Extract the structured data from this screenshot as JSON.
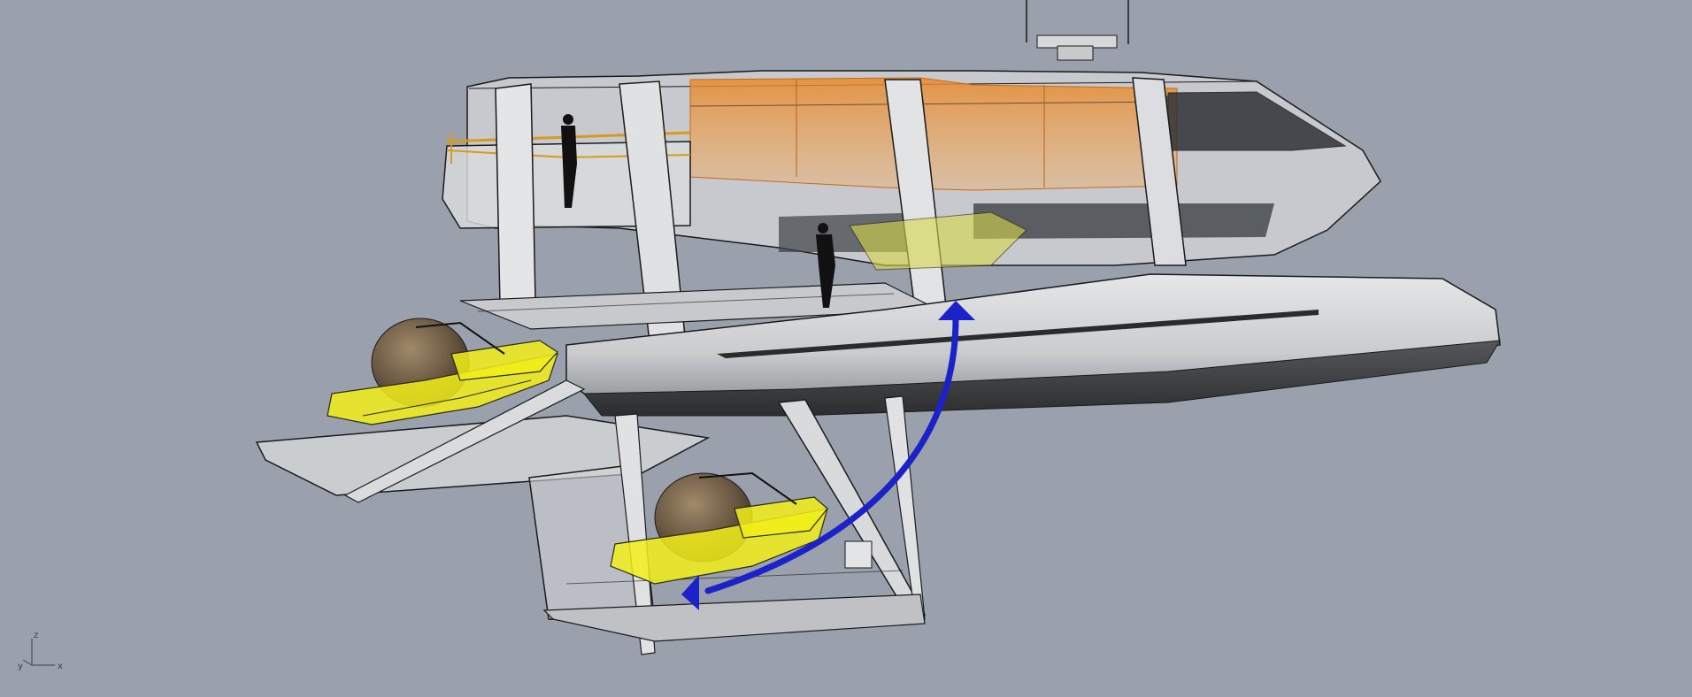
{
  "viewport": {
    "background_color": "#9aa1ac",
    "axis": {
      "z_label": "z",
      "y_label": "y",
      "x_label": "x"
    }
  },
  "colors": {
    "hull_light": "#d9dadb",
    "hull_mid": "#b9bcbf",
    "hull_dark": "#3c3d3f",
    "outline": "#1a1a1a",
    "glass": "#e8eaec",
    "interior_orange": "#e07a1c",
    "submarine_yellow": "#f2ef1a",
    "submarine_sphere": "#6b5a43",
    "arrow_blue": "#1a22c8",
    "silhouette": "#111111"
  },
  "model": {
    "name_icon": "catamaran-model",
    "arrow_icon": "deployment-arrow-icon",
    "submarine_icon": "submarine-icon",
    "person_icon": "person-silhouette-icon"
  }
}
